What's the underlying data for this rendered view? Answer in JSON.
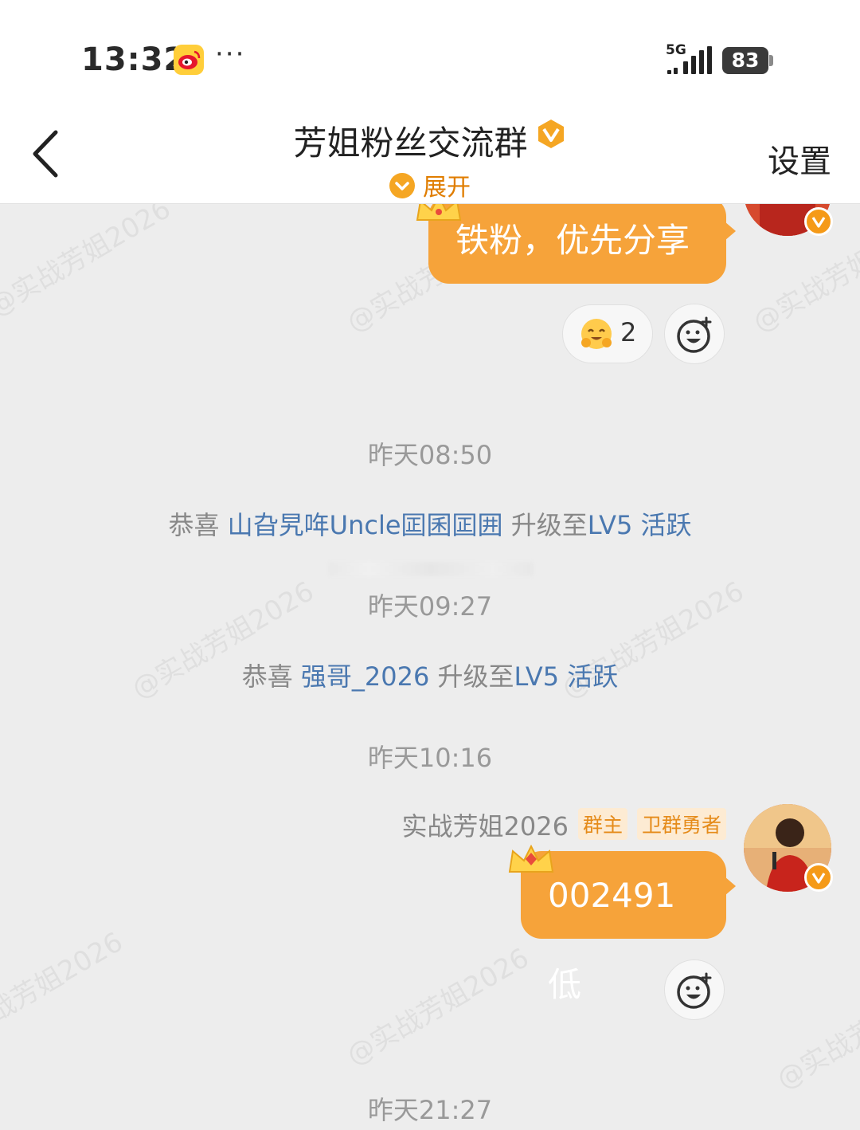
{
  "status_bar": {
    "time": "13:32",
    "more": "···",
    "network": "5G",
    "battery": "83"
  },
  "header": {
    "title": "芳姐粉丝交流群",
    "expand_label": "展开",
    "settings_label": "设置"
  },
  "watermark_text": "@实战芳姐2026",
  "messages": {
    "msg1_text": "铁粉，优先分享",
    "reaction_count": "2",
    "ts1": "昨天08:50",
    "sys1_prefix": "恭喜 ",
    "sys1_user": "山旮旯哖Uncle囸囷囸囲",
    "sys1_suffix": " 升级至",
    "sys1_level": "LV5 活跃",
    "ts2": "昨天09:27",
    "sys2_prefix": "恭喜 ",
    "sys2_user": "强哥_2026",
    "sys2_suffix": " 升级至",
    "sys2_level": "LV5 活跃",
    "ts3": "昨天10:16",
    "sender_name": "实战芳姐2026",
    "tag_owner": "群主",
    "tag_guard": "卫群勇者",
    "msg2_text": "002491低",
    "ts4": "昨天21:27"
  },
  "colors": {
    "bubble": "#f6a33a",
    "accent": "#e07d00",
    "link": "#4a78b0"
  }
}
